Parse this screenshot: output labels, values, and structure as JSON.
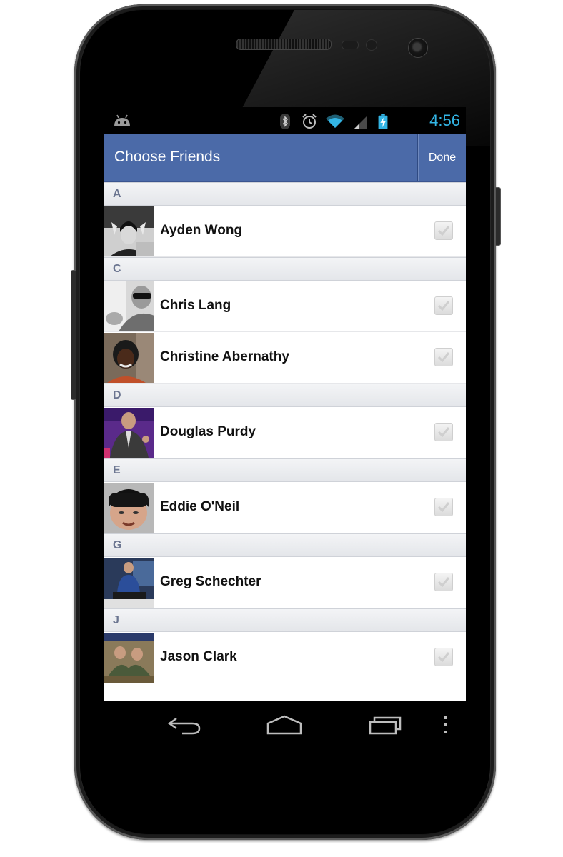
{
  "status_bar": {
    "time": "4:56",
    "icons": [
      "android-icon",
      "bluetooth-icon",
      "alarm-icon",
      "wifi-icon",
      "signal-icon",
      "battery-charging-icon"
    ]
  },
  "action_bar": {
    "title": "Choose Friends",
    "done_label": "Done"
  },
  "sections": [
    {
      "letter": "A",
      "friends": [
        {
          "name": "Ayden Wong",
          "checked": false
        }
      ]
    },
    {
      "letter": "C",
      "friends": [
        {
          "name": "Chris Lang",
          "checked": false
        },
        {
          "name": "Christine Abernathy",
          "checked": false
        }
      ]
    },
    {
      "letter": "D",
      "friends": [
        {
          "name": "Douglas Purdy",
          "checked": false
        }
      ]
    },
    {
      "letter": "E",
      "friends": [
        {
          "name": "Eddie O'Neil",
          "checked": false
        }
      ]
    },
    {
      "letter": "G",
      "friends": [
        {
          "name": "Greg Schechter",
          "checked": false
        }
      ]
    },
    {
      "letter": "J",
      "friends": [
        {
          "name": "Jason Clark",
          "checked": false
        }
      ]
    }
  ],
  "nav_bar": {
    "icons": [
      "back-icon",
      "home-icon",
      "recent-apps-icon",
      "menu-overflow-icon"
    ]
  },
  "colors": {
    "action_bar": "#4b6aa8",
    "clock": "#33b5e5",
    "section_header_text": "#6b7590"
  }
}
